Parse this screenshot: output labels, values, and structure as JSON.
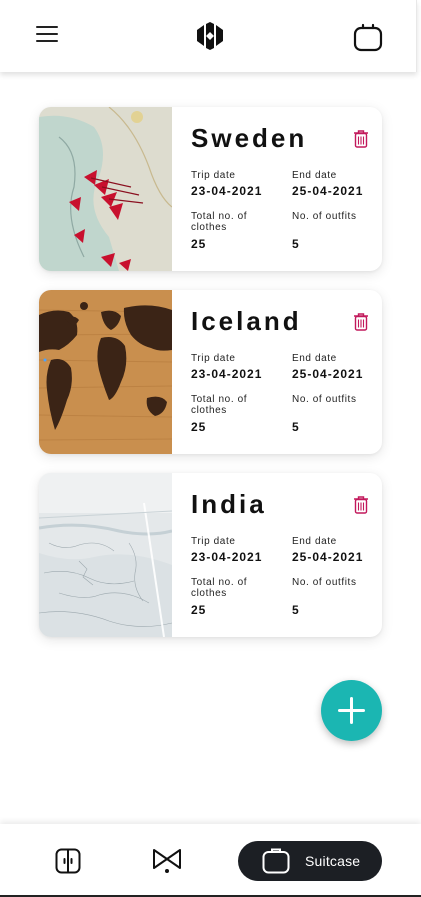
{
  "header": {
    "menu_icon": "hamburger-menu-icon",
    "logo_icon": "cube-logo-icon",
    "right_icon": "suitcase-icon"
  },
  "labels": {
    "trip_date": "Trip date",
    "end_date": "End date",
    "total_clothes": "Total no. of clothes",
    "outfits": "No. of outfits"
  },
  "trips": [
    {
      "country": "Sweden",
      "trip_date": "23-04-2021",
      "end_date": "25-04-2021",
      "total_clothes": "25",
      "outfits": "5",
      "image": "map-with-pins"
    },
    {
      "country": "Iceland",
      "trip_date": "23-04-2021",
      "end_date": "25-04-2021",
      "total_clothes": "25",
      "outfits": "5",
      "image": "wooden-world-map"
    },
    {
      "country": "India",
      "trip_date": "23-04-2021",
      "end_date": "25-04-2021",
      "total_clothes": "25",
      "outfits": "5",
      "image": "paper-map"
    }
  ],
  "fab": {
    "icon": "plus-icon"
  },
  "bottom_nav": {
    "items": [
      {
        "icon": "wardrobe-icon"
      },
      {
        "icon": "hanger-icon"
      },
      {
        "icon": "suitcase-icon",
        "label": "Suitcase",
        "active": true
      }
    ]
  },
  "colors": {
    "accent": "#1bb6b2",
    "delete": "#c2185b",
    "nav_active_bg": "#1c1f24"
  }
}
